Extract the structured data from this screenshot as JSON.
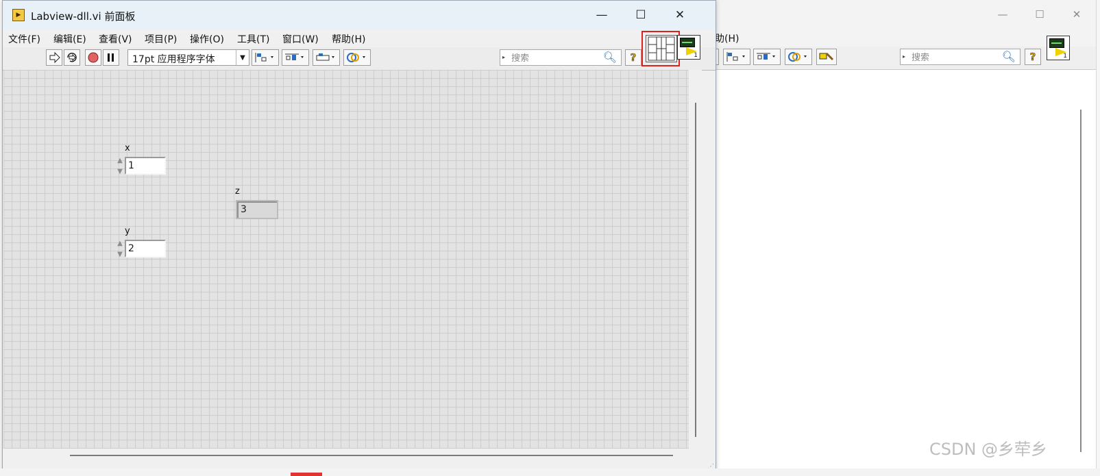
{
  "front_window": {
    "title": "Labview-dll.vi 前面板",
    "menu": [
      "文件(F)",
      "编辑(E)",
      "查看(V)",
      "项目(P)",
      "操作(O)",
      "工具(T)",
      "窗口(W)",
      "帮助(H)"
    ],
    "toolbar": {
      "font_select": "17pt 应用程序字体",
      "search_placeholder": "搜索",
      "help_label": "?"
    },
    "vi_icon_number": "1",
    "controls": [
      {
        "label": "x",
        "value": "1",
        "kind": "control"
      },
      {
        "label": "y",
        "value": "2",
        "kind": "control"
      }
    ],
    "indicators": [
      {
        "label": "z",
        "value": "3",
        "kind": "indicator"
      }
    ]
  },
  "back_window": {
    "menu": [
      "帮助(H)"
    ],
    "toolbar": {
      "search_placeholder": "搜索",
      "help_label": "?"
    },
    "vi_icon_number": "1"
  },
  "window_buttons": {
    "minimize": "—",
    "maximize": "☐",
    "close": "✕"
  },
  "watermark": "CSDN @乡荦乡"
}
